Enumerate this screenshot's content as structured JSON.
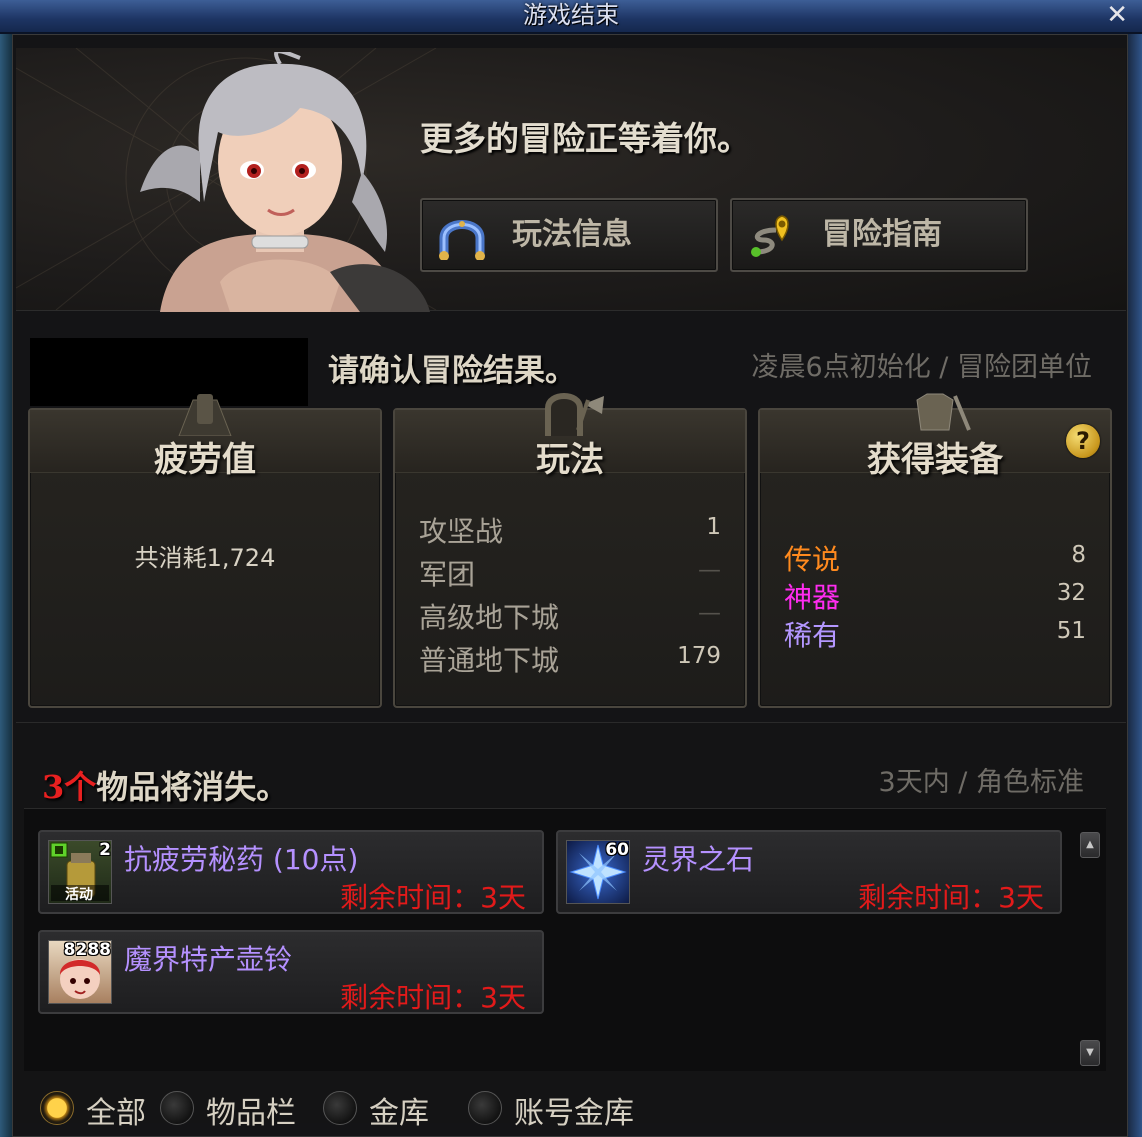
{
  "window": {
    "title": "游戏结束",
    "close_label": "✕"
  },
  "banner": {
    "message": "更多的冒险正等着你。",
    "buttons": [
      {
        "label": "玩法信息",
        "icon": "horseshoe-icon"
      },
      {
        "label": "冒险指南",
        "icon": "route-pin-icon"
      }
    ]
  },
  "results": {
    "title": "请确认冒险结果。",
    "reset_info": "凌晨6点初始化 / 冒险团单位",
    "fatigue": {
      "header": "疲劳值",
      "text": "共消耗1,724"
    },
    "gameplay": {
      "header": "玩法",
      "rows": [
        {
          "label": "攻坚战",
          "value": "1"
        },
        {
          "label": "军团",
          "value": "—"
        },
        {
          "label": "高级地下城",
          "value": "—"
        },
        {
          "label": "普通地下城",
          "value": "179"
        }
      ]
    },
    "equipment": {
      "header": "获得装备",
      "help_icon": "?",
      "rows": [
        {
          "label": "传说",
          "value": "8",
          "color": "#ff8a1e"
        },
        {
          "label": "神器",
          "value": "32",
          "color": "#ff2cf0"
        },
        {
          "label": "稀有",
          "value": "51",
          "color": "#b497ff"
        }
      ]
    }
  },
  "disappear": {
    "count": "3个",
    "title_suffix": "物品将消失。",
    "info": "3天内 / 角色标准",
    "items": [
      {
        "name": "抗疲劳秘药 (10点)",
        "time": "剩余时间：3天",
        "badge": "2",
        "tag": "活动"
      },
      {
        "name": "灵界之石",
        "time": "剩余时间：3天",
        "badge": "60"
      },
      {
        "name": "魔界特产壶铃",
        "time": "剩余时间：3天",
        "badge": "8288"
      }
    ]
  },
  "filters": {
    "options": [
      "全部",
      "物品栏",
      "金库",
      "账号金库"
    ],
    "selected": "全部"
  }
}
